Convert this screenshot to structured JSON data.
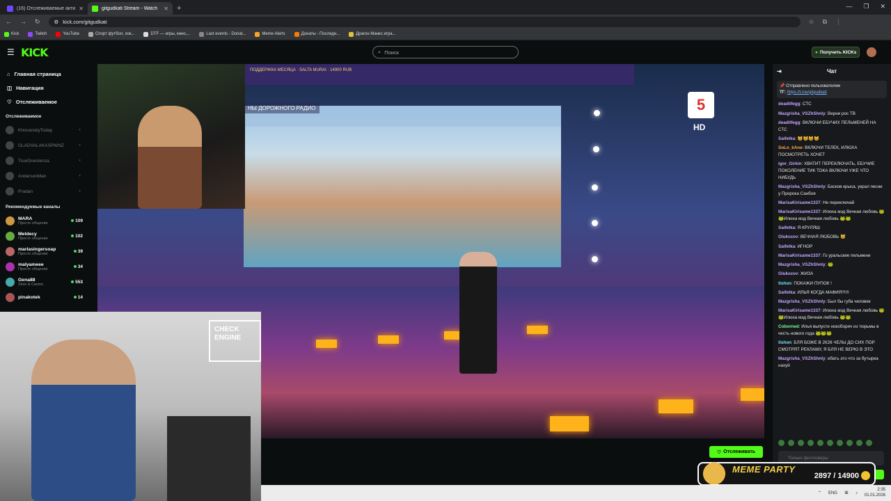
{
  "browser": {
    "tabs": [
      {
        "label": "(16) Отслеживаемые активны...",
        "active": false,
        "color": "#6c47ff"
      },
      {
        "label": "gitgudkati Stream - Watch",
        "active": true,
        "color": "#53fc18"
      }
    ],
    "url": "kick.com/gitgudkati",
    "bookmarks": [
      "Kick",
      "Twitch",
      "YouTube",
      "Спорт футбол, хок...",
      "DTF — игры, кино,...",
      "Last events - Donat...",
      "Meme Alerts",
      "Донаты - Последн...",
      "Драгон Манкс игра..."
    ]
  },
  "header": {
    "logo": "KICK",
    "search_placeholder": "Поиск",
    "kicks_label": "Получить KICKs"
  },
  "sidebar": {
    "nav": [
      {
        "label": "Главная страница",
        "icon": "home-icon"
      },
      {
        "label": "Навигация",
        "icon": "compass-icon"
      },
      {
        "label": "Отслеживаемое",
        "icon": "heart-icon"
      }
    ],
    "followed_title": "Отслеживаемое",
    "followed": [
      "KhovanskyToday",
      "GLADVALAKASPWNZ",
      "TrueGnestenza",
      "AndersonMan",
      "Pradan"
    ],
    "recommended_title": "Рекомендуемые каналы",
    "recommended": [
      {
        "name": "MARA",
        "category": "Просто общение",
        "viewers": "109",
        "color": "#c94"
      },
      {
        "name": "Meldecy",
        "category": "Просто общение",
        "viewers": "102",
        "color": "#6a4"
      },
      {
        "name": "marlasingersoap",
        "category": "Просто общение",
        "viewers": "39",
        "color": "#b66"
      },
      {
        "name": "malyameee",
        "category": "Просто общение",
        "viewers": "34",
        "color": "#a3a"
      },
      {
        "name": "Gena88",
        "category": "Slots & Casino",
        "viewers": "553",
        "color": "#4aa"
      },
      {
        "name": "pinakotek",
        "category": "",
        "viewers": "14",
        "color": "#a55"
      }
    ]
  },
  "video": {
    "banner": "НЫ ДОРОЖНОГО РАДИО",
    "channel_logo": "5",
    "channel_badge": "HD",
    "top_strip": "ПОДДЕРЖКА МЕСЯЦА · SALTA MURAI · 14900 RUB"
  },
  "follow_button": "Отслеживать",
  "chat": {
    "title": "Чат",
    "pinned_label": "Отправлено пользователем",
    "pinned_text": "ТГ:",
    "pinned_link": "https://t.me/gitgudkati",
    "messages": [
      {
        "user": "deadlifegg",
        "color": "#c6a8ff",
        "text": "СТС"
      },
      {
        "user": "Mazgrisha_VSZhShnly",
        "color": "#c6a8ff",
        "text": "Верни рос ТВ"
      },
      {
        "user": "deadlifegg",
        "color": "#c6a8ff",
        "text": "ВКЛЮЧИ ЕБУЧИХ ПЕЛЬМЕНЕЙ НА СТС"
      },
      {
        "user": "Saifetka",
        "color": "#c6a8ff",
        "text": "😺😺😺😺"
      },
      {
        "user": "SoLo_kAne",
        "color": "#ffa94d",
        "text": "ВКЛЮЧИ ТЕЛЕК, ИЛЮХА ПОСМОТРЕТЬ ХОЧЕТ"
      },
      {
        "user": "igor_Girkin",
        "color": "#c6a8ff",
        "text": "ХВАТИТ ПЕРЕКЛЮЧАТЬ, ЕБУЧИЕ ПОКОЛЕНИЕ ТИК ТОКА ВКЛЮЧИ УЖЕ ЧТО НИБУДЬ"
      },
      {
        "user": "Mazgrisha_VSZhShnly",
        "color": "#c6a8ff",
        "text": "Басков крыса, украл песни у Пророка Санбоя"
      },
      {
        "user": "MarisaKirisame1337",
        "color": "#c6a8ff",
        "text": "Не переключай"
      },
      {
        "user": "MarisaKirisame1337",
        "color": "#c6a8ff",
        "text": "Илюха мэд Вечная любовь 🐸🐸Илюха мэд Вечная любовь 🐸🐸"
      },
      {
        "user": "Saifetka",
        "color": "#c6a8ff",
        "text": "Я КРУЛЯШ"
      },
      {
        "user": "Glukozov",
        "color": "#c6a8ff",
        "text": "ВЕЧНАЯ ЛЮБОВЬ 🐱"
      },
      {
        "user": "Saifetka",
        "color": "#c6a8ff",
        "text": "ИГНОР"
      },
      {
        "user": "MarisaKirisame1337",
        "color": "#c6a8ff",
        "text": "Го уральские пельмени"
      },
      {
        "user": "Mazgrisha_VSZhShnly",
        "color": "#c6a8ff",
        "text": "🐸"
      },
      {
        "user": "Glukozov",
        "color": "#c6a8ff",
        "text": "ЖИЗА"
      },
      {
        "user": "tlshon",
        "color": "#7ee0ff",
        "text": "ПОКАЖИ ПУПОК !"
      },
      {
        "user": "Saifetka",
        "color": "#c6a8ff",
        "text": "ИЛЬЯ КОГДА МАФИЯ?!!!!"
      },
      {
        "user": "Mazgrisha_VSZhShnly",
        "color": "#c6a8ff",
        "text": "Был бы губа человек"
      },
      {
        "user": "MarisaKirisame1337",
        "color": "#c6a8ff",
        "text": "Илюха мэд Вечная любовь 🐸🐸Илюха мэд Вечная любовь 🐸🐸"
      },
      {
        "user": "Coborned",
        "color": "#7dff9a",
        "text": "Илья выпусти нокоборич из тюрьмы в честь нового года 🐸🐸🐸"
      },
      {
        "user": "tlshon",
        "color": "#7ee0ff",
        "text": "БЛЯ БОЖЕ В 2К26 ЧЕЛЫ ДО СИХ ПОР СМОТРЯТ РЕКЛАМУ, Я БЛЯ НЕ ВЕРЮ В ЭТО"
      },
      {
        "user": "Mazgrisha_VSZhShnly",
        "color": "#c6a8ff",
        "text": "ебать это что за бутырка нахуй"
      }
    ],
    "input_placeholder": "Только фолловеры"
  },
  "overlay": {
    "title": "MEME PARTY",
    "counter": "2897 / 14900"
  },
  "taskbar": {
    "lang": "ENG",
    "time": "2:35",
    "date": "01.01.2026"
  }
}
